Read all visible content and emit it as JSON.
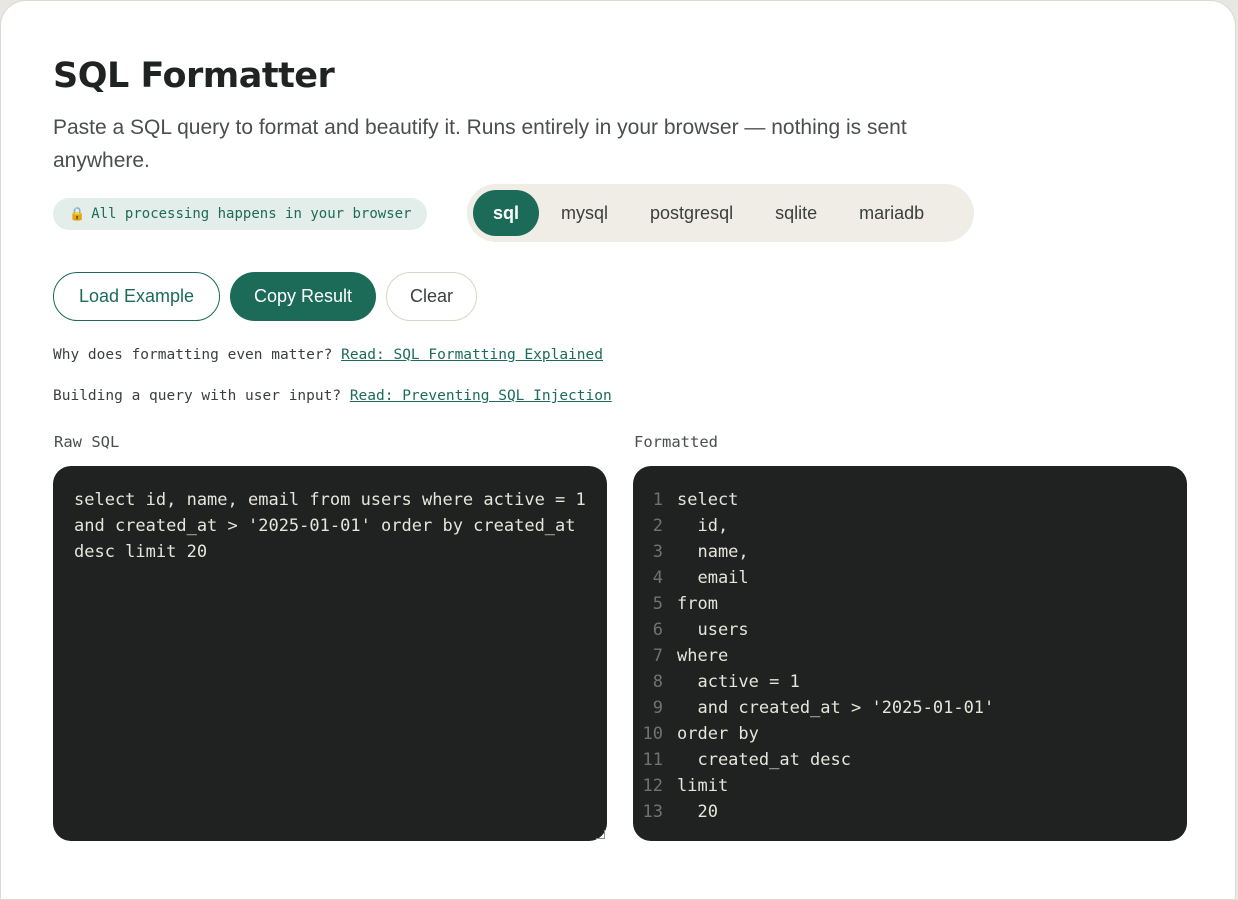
{
  "header": {
    "title": "SQL Formatter",
    "subtitle": "Paste a SQL query to format and beautify it. Runs entirely in your browser — nothing is sent anywhere."
  },
  "privacy_badge": {
    "icon": "lock-icon",
    "icon_glyph": "🔒",
    "text": "All processing happens in your browser"
  },
  "dialects": {
    "selected": "sql",
    "options": [
      "sql",
      "mysql",
      "postgresql",
      "sqlite",
      "mariadb"
    ]
  },
  "actions": {
    "load_example": "Load Example",
    "copy_result": "Copy Result",
    "clear": "Clear"
  },
  "notes": [
    {
      "text": "Why does formatting even matter? ",
      "link": "Read: SQL Formatting Explained"
    },
    {
      "text": "Building a query with user input? ",
      "link": "Read: Preventing SQL Injection"
    }
  ],
  "panes": {
    "raw_label": "Raw SQL",
    "formatted_label": "Formatted",
    "raw_sql": "select id, name, email from users where active = 1 and created_at > '2025-01-01' order by created_at desc limit 20",
    "formatted_lines": [
      {
        "n": "1",
        "code": "select"
      },
      {
        "n": "2",
        "code": "  id,"
      },
      {
        "n": "3",
        "code": "  name,"
      },
      {
        "n": "4",
        "code": "  email"
      },
      {
        "n": "5",
        "code": "from"
      },
      {
        "n": "6",
        "code": "  users"
      },
      {
        "n": "7",
        "code": "where"
      },
      {
        "n": "8",
        "code": "  active = 1"
      },
      {
        "n": "9",
        "code": "  and created_at > '2025-01-01'"
      },
      {
        "n": "10",
        "code": "order by"
      },
      {
        "n": "11",
        "code": "  created_at desc"
      },
      {
        "n": "12",
        "code": "limit"
      },
      {
        "n": "13",
        "code": "  20"
      }
    ]
  },
  "colors": {
    "accent": "#1b6b58",
    "editor_bg": "#1f2221",
    "pill_bg": "#e3eeea",
    "segmented_bg": "#efede6"
  }
}
